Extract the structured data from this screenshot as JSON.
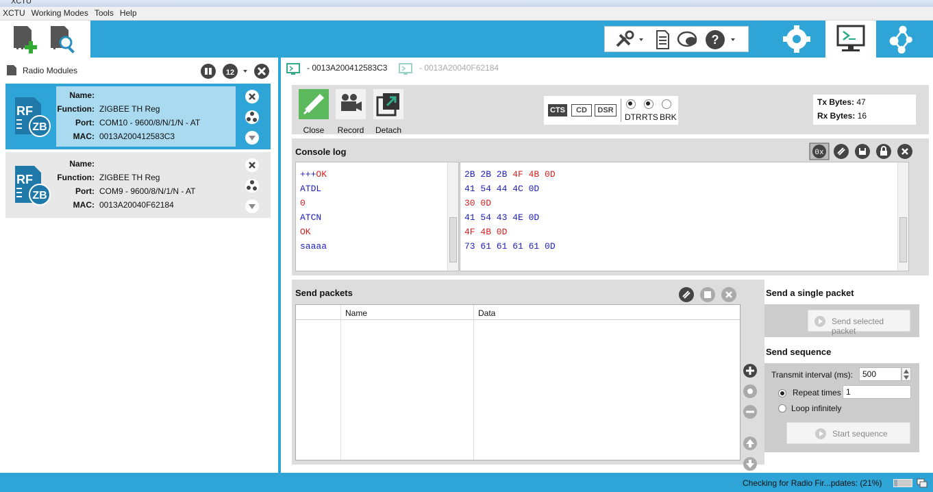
{
  "window": {
    "title": "XCTU"
  },
  "menu": [
    "XCTU",
    "Working Modes",
    "Tools",
    "Help"
  ],
  "radio_modules": {
    "title": "Radio Modules",
    "field_labels": {
      "name": "Name:",
      "function": "Function:",
      "port": "Port:",
      "mac": "MAC:"
    },
    "devices": [
      {
        "name": "",
        "function": "ZIGBEE TH Reg",
        "port": "COM10 - 9600/8/N/1/N - AT",
        "mac": "0013A200412583C3",
        "selected": true
      },
      {
        "name": "",
        "function": "ZIGBEE TH Reg",
        "port": "COM9 - 9600/8/N/1/N - AT",
        "mac": "0013A20040F62184",
        "selected": false
      }
    ],
    "badge": {
      "top": "RF",
      "bottom": "ZB"
    }
  },
  "tabs": [
    {
      "label": "- 0013A200412583C3",
      "active": true
    },
    {
      "label": "- 0013A20040F62184",
      "active": false
    }
  ],
  "connection": {
    "buttons": {
      "close": "Close",
      "record": "Record",
      "detach": "Detach"
    },
    "lines": {
      "cts": "CTS",
      "cd": "CD",
      "dsr": "DSR",
      "dtr": "DTR",
      "rts": "RTS",
      "brk": "BRK"
    },
    "tx_label": "Tx Bytes:",
    "tx_value": "47",
    "rx_label": "Rx Bytes:",
    "rx_value": "16"
  },
  "console": {
    "title": "Console log",
    "hex_button": "0x",
    "text_lines": [
      {
        "parts": [
          {
            "t": "+++",
            "c": "blue"
          },
          {
            "t": "OK",
            "c": "red"
          }
        ]
      },
      {
        "parts": [
          {
            "t": "ATDL",
            "c": "blue"
          }
        ]
      },
      {
        "parts": [
          {
            "t": "0",
            "c": "red"
          }
        ]
      },
      {
        "parts": [
          {
            "t": "ATCN",
            "c": "blue"
          }
        ]
      },
      {
        "parts": [
          {
            "t": "OK",
            "c": "red"
          }
        ]
      },
      {
        "parts": [
          {
            "t": "saaaa",
            "c": "blue"
          }
        ]
      }
    ],
    "hex_lines": [
      {
        "parts": [
          {
            "t": "2B 2B 2B ",
            "c": "blue"
          },
          {
            "t": "4F 4B 0D",
            "c": "red"
          }
        ]
      },
      {
        "parts": [
          {
            "t": "41 54 44 4C 0D",
            "c": "blue"
          }
        ]
      },
      {
        "parts": [
          {
            "t": "30 0D",
            "c": "red"
          }
        ]
      },
      {
        "parts": [
          {
            "t": "41 54 43 4E 0D",
            "c": "blue"
          }
        ]
      },
      {
        "parts": [
          {
            "t": "4F 4B 0D",
            "c": "red"
          }
        ]
      },
      {
        "parts": [
          {
            "t": "73 61 61 61 61 0D",
            "c": "blue"
          }
        ]
      }
    ]
  },
  "send_packets": {
    "title": "Send packets",
    "columns": [
      "",
      "Name",
      "Data"
    ]
  },
  "single_packet": {
    "title": "Send a single packet",
    "button": "Send selected packet"
  },
  "sequence": {
    "title": "Send sequence",
    "interval_label": "Transmit interval (ms):",
    "interval_value": "500",
    "repeat_label": "Repeat times",
    "repeat_value": "1",
    "loop_label": "Loop infinitely",
    "repeat_selected": true,
    "button": "Start sequence"
  },
  "status": {
    "text": "Checking for Radio Fir...pdates: (21%)",
    "progress": 0.21
  },
  "colors": {
    "accent": "#2fa4d6",
    "selected_info": "#a9daf0",
    "blue_text": "#1d1dbb",
    "red_text": "#d42020"
  }
}
